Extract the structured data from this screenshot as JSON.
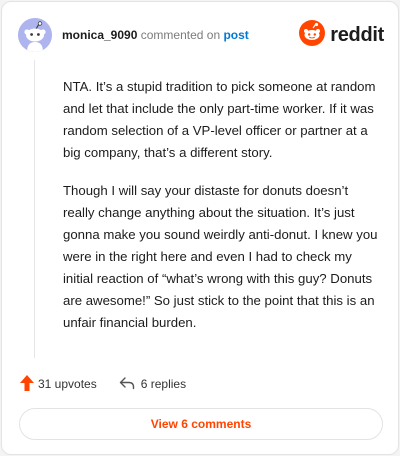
{
  "header": {
    "username": "monica_9090",
    "action_text": "commented on",
    "post_link": "post",
    "brand_wordmark": "reddit",
    "brand_icon": "reddit-logo-icon",
    "avatar_icon": "snoo-avatar-icon"
  },
  "comment": {
    "paragraphs": [
      "NTA. It’s a stupid tradition to pick someone at random and let that include the only part-time worker. If it was random selection of a VP-level officer or partner at a big company, that’s a different story.",
      "Though I will say your distaste for donuts doesn’t really change anything about the situation. It’s just gonna make you sound weirdly anti-donut. I knew you were in the right here and even I had to check my initial reaction of “what’s wrong with this guy? Donuts are awesome!” So just stick to the point that this is an unfair financial burden."
    ]
  },
  "actions": {
    "upvotes": "31 upvotes",
    "replies": "6 replies",
    "upvote_icon": "upvote-arrow-icon",
    "reply_icon": "reply-arrow-icon"
  },
  "footer": {
    "view_comments_label": "View 6 comments"
  },
  "colors": {
    "brand": "#ff4500",
    "link": "#0079d3",
    "avatar": "#aeb4ee",
    "text": "#1c1c1c",
    "muted": "#7c7c7c"
  }
}
